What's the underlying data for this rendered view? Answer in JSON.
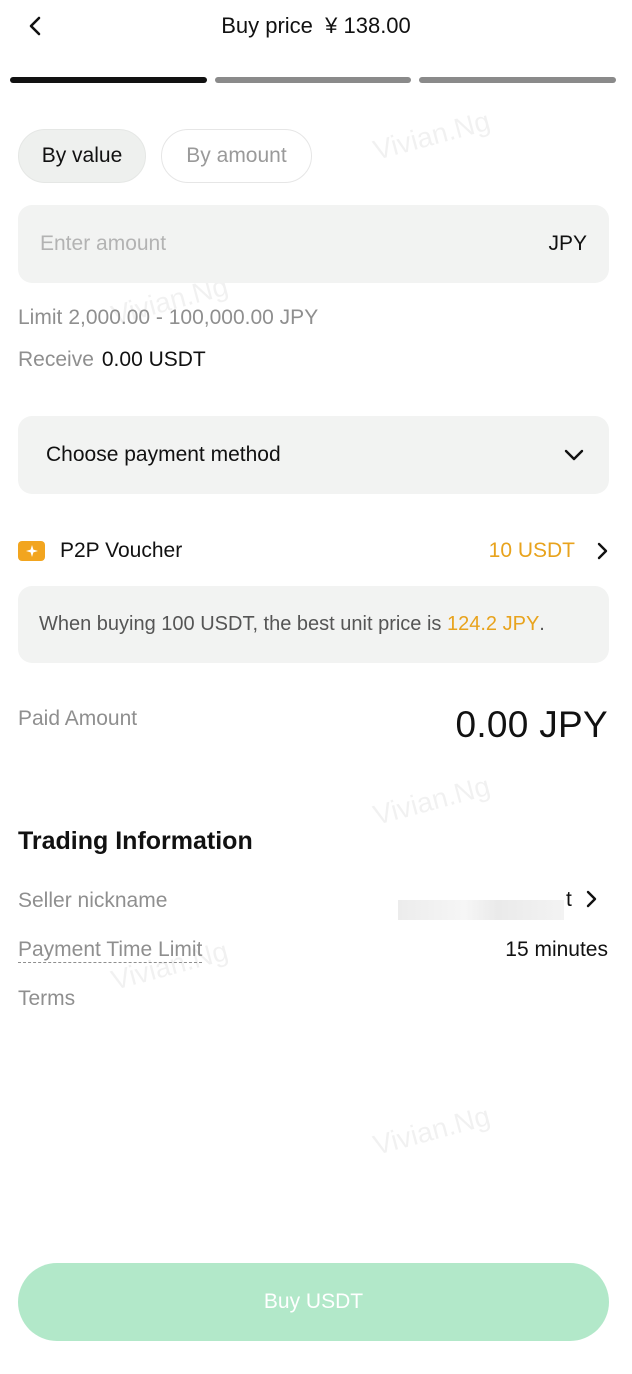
{
  "header": {
    "title": "Buy price  ¥ 138.00"
  },
  "progress": {
    "steps": 3,
    "current": 1
  },
  "tabs": [
    {
      "label": "By value",
      "active": true
    },
    {
      "label": "By amount",
      "active": false
    }
  ],
  "amount_input": {
    "placeholder": "Enter amount",
    "value": "",
    "currency": "JPY"
  },
  "limit": {
    "label": "Limit",
    "value": "2,000.00 - 100,000.00 JPY"
  },
  "receive": {
    "label": "Receive",
    "value": "0.00 USDT"
  },
  "payment_method": {
    "placeholder": "Choose payment method"
  },
  "voucher": {
    "label": "P2P Voucher",
    "amount": "10 USDT",
    "note_prefix": "When buying 100 USDT, the best unit price is ",
    "note_price": "124.2 JPY",
    "note_suffix": "."
  },
  "paid": {
    "label": "Paid Amount",
    "value": "0.00 JPY"
  },
  "trading_info": {
    "title": "Trading Information",
    "seller_label": "Seller nickname",
    "seller_visible": "t",
    "payment_limit_label": "Payment Time Limit",
    "payment_limit_value": "15 minutes",
    "terms_label": "Terms"
  },
  "buy_button": {
    "label": "Buy USDT"
  },
  "watermark": {
    "name": "Vivian.Ng"
  },
  "colors": {
    "accent_orange": "#e8a31d",
    "button_green_disabled": "#b2e8c9",
    "field_bg": "#f2f3f2"
  }
}
